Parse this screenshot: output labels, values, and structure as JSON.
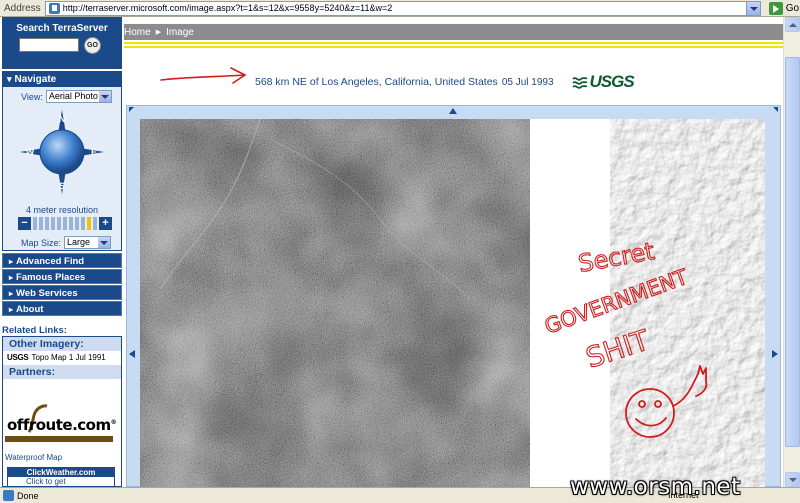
{
  "browser": {
    "address_label": "Address",
    "url": "http://terraserver.microsoft.com/image.aspx?t=1&s=12&x=9558y=5240&z=11&w=2",
    "go_label": "Go",
    "status": "Done",
    "zone": "Internet"
  },
  "sidebar": {
    "search_title": "Search TerraServer",
    "search_go": "GO",
    "navigate_title": "Navigate",
    "view_label": "View:",
    "view_value": "Aerial Photo",
    "compass": {
      "n": "N",
      "s": "S",
      "e": "E",
      "w": "W"
    },
    "resolution": "4 meter resolution",
    "map_size_label": "Map Size:",
    "map_size_value": "Large",
    "menu": [
      {
        "label": "Advanced Find"
      },
      {
        "label": "Famous Places"
      },
      {
        "label": "Web Services"
      },
      {
        "label": "About"
      }
    ],
    "related_title": "Related Links:",
    "other_imagery_title": "Other Imagery:",
    "topo_brand": "USGS",
    "topo_label": "Topo Map 1 Jul 1991",
    "partners_title": "Partners:",
    "offroute_a": "off",
    "offroute_b": "route",
    "offroute_c": ".com",
    "offroute_tm": "®",
    "waterproof": "Waterproof Map",
    "clickweather_title": "ClickWeather.com",
    "clickweather_text": "Click to get"
  },
  "main": {
    "breadcrumb": [
      {
        "label": "Home"
      },
      {
        "label": "Image"
      }
    ],
    "place": "568 km NE of Los Angeles, California, United States",
    "date": "05 Jul 1993",
    "brand": "USGS"
  },
  "annotation": {
    "line1": "Secret",
    "line2": "GOVERNMENT",
    "line3": "SHIT",
    "color": "#d21c1c"
  },
  "watermark": "www.orsm.net",
  "colors": {
    "nav_blue": "#1b4a8a",
    "accent_yellow": "#f2e400",
    "usgs_green": "#0d5a2e"
  }
}
